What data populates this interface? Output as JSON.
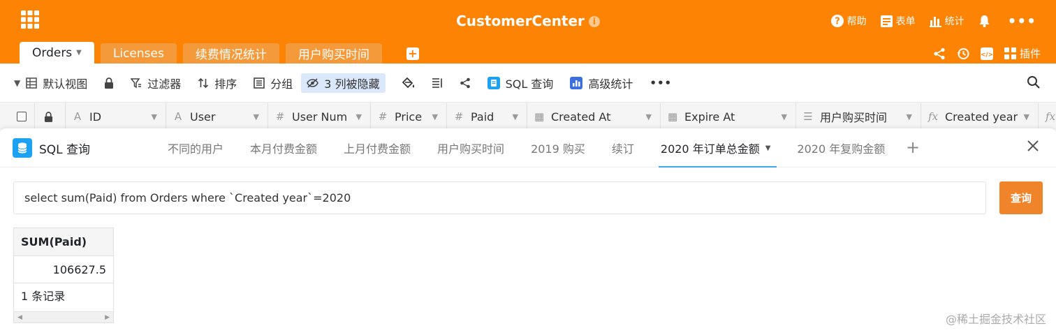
{
  "header": {
    "title": "CustomerCenter",
    "help_label": "帮助",
    "form_label": "表单",
    "stats_label": "统计",
    "plugins_label": "插件",
    "color": "#fd8305"
  },
  "tabs": [
    {
      "label": "Orders",
      "active": true
    },
    {
      "label": "Licenses"
    },
    {
      "label": "续费情况统计"
    },
    {
      "label": "用户购买时间"
    }
  ],
  "toolbar": {
    "view_label": "默认视图",
    "filter_label": "过滤器",
    "sort_label": "排序",
    "group_label": "分组",
    "hidden_label": "3 列被隐藏",
    "sql_label": "SQL 查询",
    "advanced_stats_label": "高级统计"
  },
  "columns": [
    {
      "name": "ID",
      "icon": "text-icon"
    },
    {
      "name": "User",
      "icon": "text-icon"
    },
    {
      "name": "User Num",
      "icon": "number-icon"
    },
    {
      "name": "Price",
      "icon": "number-icon"
    },
    {
      "name": "Paid",
      "icon": "number-icon"
    },
    {
      "name": "Created At",
      "icon": "date-icon"
    },
    {
      "name": "Expire At",
      "icon": "date-icon"
    },
    {
      "name": "用户购买时间",
      "icon": "link-icon"
    },
    {
      "name": "Created year",
      "icon": "formula-icon"
    }
  ],
  "sql_panel": {
    "title": "SQL 查询",
    "query_tabs": [
      {
        "label": "不同的用户"
      },
      {
        "label": "本月付费金额"
      },
      {
        "label": "上月付费金额"
      },
      {
        "label": "用户购买时间"
      },
      {
        "label": "2019 购买"
      },
      {
        "label": "续订"
      },
      {
        "label": "2020 年订单总金额",
        "active": true
      },
      {
        "label": "2020 年复购金额"
      }
    ],
    "query": "select sum(Paid) from Orders where `Created year`=2020",
    "run_label": "查询",
    "result": {
      "column": "SUM(Paid)",
      "value": "106627.5",
      "count_label": "1 条记录"
    }
  },
  "watermark": "@稀土掘金技术社区"
}
